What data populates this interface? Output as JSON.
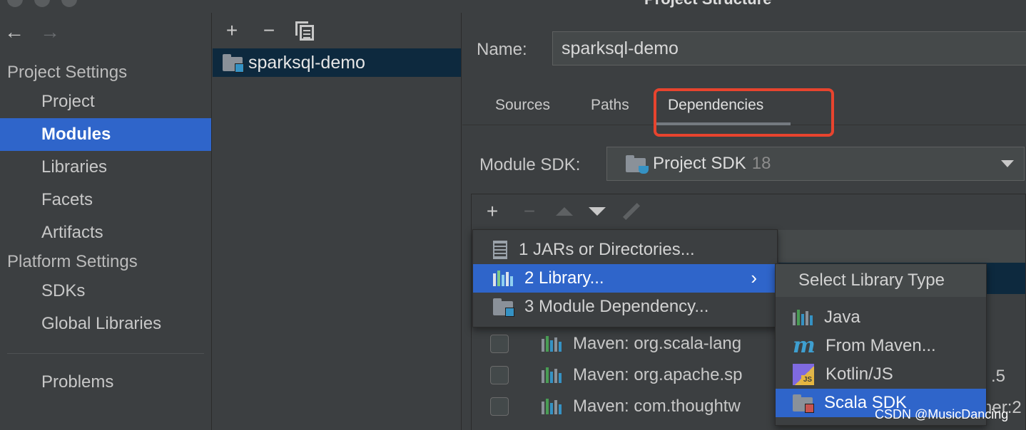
{
  "window": {
    "title": "Project Structure"
  },
  "nav": {
    "back_icon": "arrow-left-icon",
    "forward_icon": "arrow-right-icon",
    "project_settings_header": "Project Settings",
    "platform_settings_header": "Platform Settings",
    "items": [
      {
        "label": "Project"
      },
      {
        "label": "Modules"
      },
      {
        "label": "Libraries"
      },
      {
        "label": "Facets"
      },
      {
        "label": "Artifacts"
      },
      {
        "label": "SDKs"
      },
      {
        "label": "Global Libraries"
      },
      {
        "label": "Problems"
      }
    ],
    "selected": "Modules"
  },
  "modules_panel": {
    "toolbar": {
      "add": "+",
      "remove": "−"
    },
    "modules": [
      {
        "name": "sparksql-demo"
      }
    ]
  },
  "module": {
    "name_label": "Name:",
    "name_value": "sparksql-demo",
    "tabs": [
      {
        "label": "Sources"
      },
      {
        "label": "Paths"
      },
      {
        "label": "Dependencies"
      }
    ],
    "active_tab": "Dependencies",
    "sdk_label": "Module SDK:",
    "sdk_value": "Project SDK",
    "sdk_version": "18"
  },
  "dependencies": {
    "toolbar": {
      "add": "+",
      "remove": "−"
    },
    "rows": [
      {
        "text": "Maven: org.scala-lang"
      },
      {
        "text": "Maven: org.apache.sp"
      },
      {
        "text": "Maven: com.thoughtw"
      }
    ],
    "partial_text": {
      "row2_suffix": ".5",
      "row3_suffix": "ner:2"
    }
  },
  "add_menu": {
    "items": [
      {
        "label": "1  JARs or Directories..."
      },
      {
        "label": "2  Library..."
      },
      {
        "label": "3  Module Dependency..."
      }
    ],
    "selected": "2  Library...",
    "chevron": "›"
  },
  "library_type_menu": {
    "title": "Select Library Type",
    "items": [
      {
        "label": "Java"
      },
      {
        "label": "From Maven..."
      },
      {
        "label": "Kotlin/JS"
      },
      {
        "label": "Scala SDK"
      }
    ],
    "selected": "Scala SDK",
    "kotlin_badge": "JS",
    "maven_glyph": "m"
  },
  "annotation": {
    "highlight_color": "#e8442e"
  },
  "colors": {
    "selection": "#2f65ca",
    "background": "#3c3f41",
    "dark_selection": "#0d293e"
  },
  "watermark": "CSDN @MusicDancing"
}
